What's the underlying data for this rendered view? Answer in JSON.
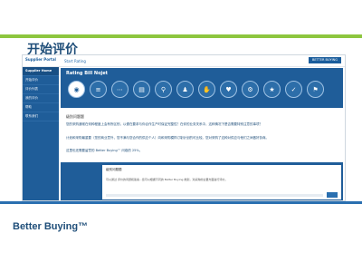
{
  "slide": {
    "title": "开始评价",
    "brand": "Better Buying™"
  },
  "app": {
    "logo": "Supplier Portal",
    "breadcrumb": "Start Rating",
    "top_badge": "BETTER BUYING",
    "sidebar": [
      {
        "label": "Supplier Home",
        "head": true
      },
      {
        "label": "开始评价"
      },
      {
        "label": "评价列表"
      },
      {
        "label": "我的评价"
      },
      {
        "label": "帮助"
      },
      {
        "label": "联系我们"
      }
    ]
  },
  "banner": {
    "title": "Rating Bill Nojet"
  },
  "icons": [
    {
      "name": "eye-icon",
      "glyph": "◉"
    },
    {
      "name": "list-icon",
      "glyph": "≡"
    },
    {
      "name": "dots-icon",
      "glyph": "⋯"
    },
    {
      "name": "chart-icon",
      "glyph": "▤"
    },
    {
      "name": "pin-icon",
      "glyph": "⚲"
    },
    {
      "name": "user-icon",
      "glyph": "♟"
    },
    {
      "name": "thumb-icon",
      "glyph": "✋"
    },
    {
      "name": "heart-icon",
      "glyph": "♥"
    },
    {
      "name": "gear-icon",
      "glyph": "⚙"
    },
    {
      "name": "star-icon",
      "glyph": "★"
    },
    {
      "name": "check-icon",
      "glyph": "✓"
    },
    {
      "name": "flag-icon",
      "glyph": "⚑"
    }
  ],
  "content": {
    "section_title": "级别问题题",
    "p1": "您的采购通常在何种程度上会有所区别，以便在要求与你合作生产时保证完整性？在你的业务关系中，这种情况下是否需要特别注意的事项？",
    "p2": "计划和采购最重要（您的商业意外，您不满与您合作的供应个人）向和采购模样订制计划的可比较。您对采购了这种对供应与他们之间做好协商。",
    "p3": "这里也还需要留意的 Better Buying™ 问卷的 25%。",
    "p4": ""
  },
  "lower": {
    "title": "级别问题题",
    "text": "可以通过 评价的问题和答案...您可以根据不同的 Better Buying 类别，对采购的主要方面进行评价。"
  }
}
